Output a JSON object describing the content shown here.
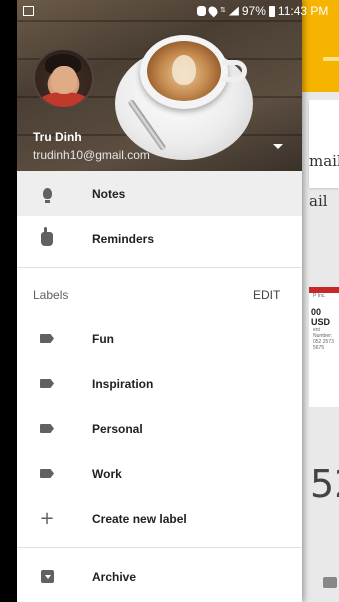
{
  "status_bar": {
    "battery": "97%",
    "time": "11:43 PM"
  },
  "background_app": {
    "text_1": "mail",
    "text_2": "ail",
    "doc_amount": "00 USD",
    "doc_line_1": "P Inc.",
    "doc_line_2": "ent Number:",
    "doc_line_3": "052 2573 5675",
    "number": "52"
  },
  "drawer": {
    "account": {
      "name": "Tru Dinh",
      "email": "trudinh10@gmail.com"
    },
    "primary_items": [
      {
        "label": "Notes",
        "icon": "lightbulb-icon",
        "active": true
      },
      {
        "label": "Reminders",
        "icon": "reminder-hand-icon",
        "active": false
      }
    ],
    "labels_section": {
      "title": "Labels",
      "edit": "EDIT",
      "items": [
        {
          "label": "Fun",
          "icon": "label-icon"
        },
        {
          "label": "Inspiration",
          "icon": "label-icon"
        },
        {
          "label": "Personal",
          "icon": "label-icon"
        },
        {
          "label": "Work",
          "icon": "label-icon"
        }
      ],
      "create": {
        "label": "Create new label",
        "icon": "plus-icon"
      }
    },
    "archive": {
      "label": "Archive",
      "icon": "archive-icon"
    }
  },
  "colors": {
    "accent": "#f6b400",
    "active_row": "#eeeeee",
    "icon": "#616161"
  }
}
